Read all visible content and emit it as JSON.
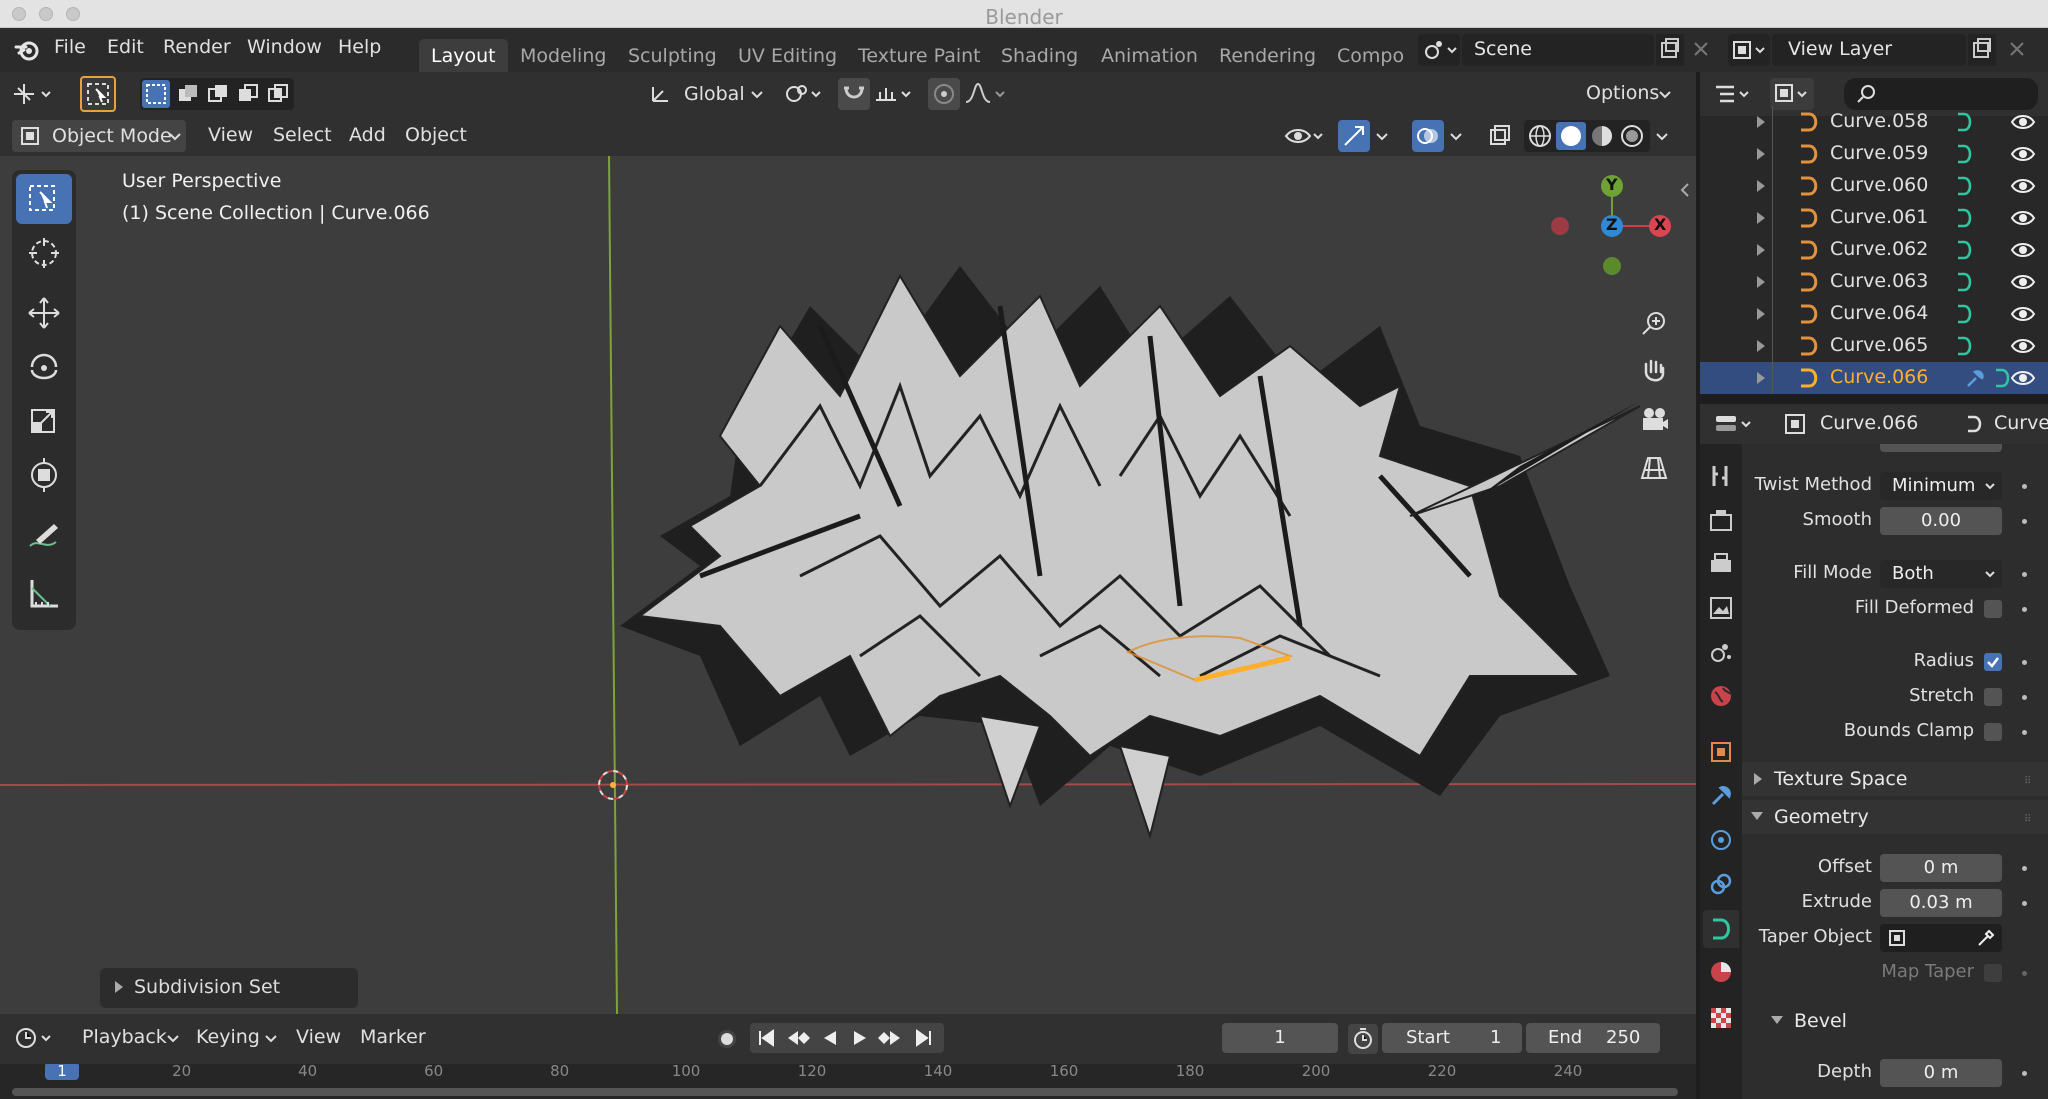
{
  "window": {
    "title": "Blender"
  },
  "menus": [
    "File",
    "Edit",
    "Render",
    "Window",
    "Help"
  ],
  "workspaces": [
    {
      "label": "Layout",
      "active": true
    },
    {
      "label": "Modeling",
      "active": false
    },
    {
      "label": "Sculpting",
      "active": false
    },
    {
      "label": "UV Editing",
      "active": false
    },
    {
      "label": "Texture Paint",
      "active": false
    },
    {
      "label": "Shading",
      "active": false
    },
    {
      "label": "Animation",
      "active": false
    },
    {
      "label": "Rendering",
      "active": false
    },
    {
      "label": "Compo",
      "active": false
    }
  ],
  "scene": {
    "name": "Scene"
  },
  "view_layer": {
    "name": "View Layer"
  },
  "tool_header": {
    "orientation": "Global",
    "options": "Options"
  },
  "view_header": {
    "mode": "Object Mode",
    "menus": [
      "View",
      "Select",
      "Add",
      "Object"
    ]
  },
  "viewport": {
    "perspective": "User Perspective",
    "collection": "(1) Scene Collection | Curve.066",
    "gizmo": {
      "y": "Y",
      "z": "Z",
      "x": "X"
    },
    "last_op": "Subdivision Set",
    "accent": "#4772b3"
  },
  "outliner": {
    "items": [
      {
        "name": "Curve.058",
        "selected": false
      },
      {
        "name": "Curve.059",
        "selected": false
      },
      {
        "name": "Curve.060",
        "selected": false
      },
      {
        "name": "Curve.061",
        "selected": false
      },
      {
        "name": "Curve.062",
        "selected": false
      },
      {
        "name": "Curve.063",
        "selected": false
      },
      {
        "name": "Curve.064",
        "selected": false
      },
      {
        "name": "Curve.065",
        "selected": false
      },
      {
        "name": "Curve.066",
        "selected": true
      }
    ],
    "selected_color": "#ffaf29"
  },
  "properties": {
    "object_name": "Curve.066",
    "data_name": "Curve",
    "twist_method": {
      "label": "Twist Method",
      "value": "Minimum"
    },
    "smooth": {
      "label": "Smooth",
      "value": "0.00"
    },
    "fill_mode": {
      "label": "Fill Mode",
      "value": "Both"
    },
    "fill_deformed": {
      "label": "Fill Deformed",
      "checked": false
    },
    "radius": {
      "label": "Radius",
      "checked": true
    },
    "stretch": {
      "label": "Stretch",
      "checked": false
    },
    "bounds_clamp": {
      "label": "Bounds Clamp",
      "checked": false
    },
    "texture_space": {
      "label": "Texture Space",
      "expanded": false
    },
    "geometry": {
      "label": "Geometry",
      "expanded": true
    },
    "offset": {
      "label": "Offset",
      "value": "0 m"
    },
    "extrude": {
      "label": "Extrude",
      "value": "0.03 m"
    },
    "taper_object": {
      "label": "Taper Object"
    },
    "map_taper": {
      "label": "Map Taper",
      "checked": false
    },
    "bevel": {
      "label": "Bevel",
      "expanded": true
    },
    "depth": {
      "label": "Depth",
      "value": "0 m"
    }
  },
  "timeline": {
    "menus": [
      "Playback",
      "Keying",
      "View",
      "Marker"
    ],
    "current_frame": "1",
    "start_label": "Start",
    "start": "1",
    "end_label": "End",
    "end": "250",
    "ruler": [
      "1",
      "20",
      "40",
      "60",
      "80",
      "100",
      "120",
      "140",
      "160",
      "180",
      "200",
      "220",
      "240"
    ]
  }
}
